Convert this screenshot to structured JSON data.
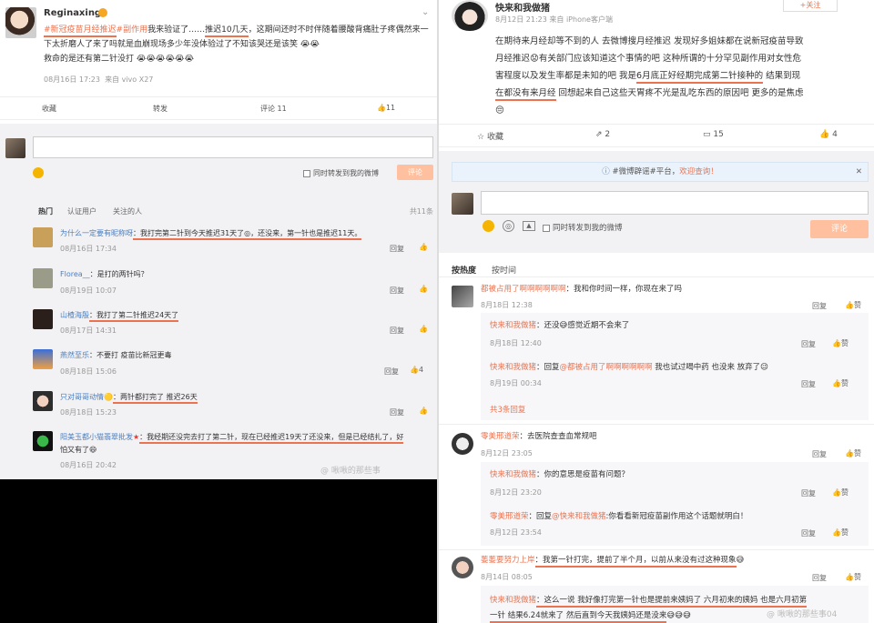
{
  "left": {
    "post": {
      "username": "Reginaxing",
      "tags": [
        "#新冠疫苗月经推迟",
        "#副作用"
      ],
      "text_1": "我来验证了……",
      "text_2": "推迟10几天",
      "text_3": "，这期间还时不时伴随着腰酸背痛肚子",
      "text_4": "疼偶然来一下太折磨人了来了吗就是血崩现场多少年没体验过了不知该哭还是该笑",
      "text_5": "救命的是还有第二针没打",
      "time": "08月16日 17:23",
      "source": "来自 vivo X27"
    },
    "actions": {
      "fav": "收藏",
      "share": "转发",
      "comment": "评论 11",
      "like": "11"
    },
    "composer": {
      "also_share": "同时转发到我的微博",
      "submit": "评论"
    },
    "filters": {
      "hot": "热门",
      "verified": "认证用户",
      "following": "关注的人",
      "count": "共11条"
    },
    "comments": [
      {
        "user": "为什么一定要有昵称呀",
        "text": "：我打完第二针到今天推迟31天了◎，还没来，第一针也是推迟11天。",
        "time": "08月16日 17:34",
        "reply": "回复",
        "likes": ""
      },
      {
        "user": "Florea__",
        "text": "：是打的两针吗？",
        "time": "08月19日 10:07",
        "reply": "回复",
        "likes": ""
      },
      {
        "user": "山楂海殷",
        "text": "：我打了第二针推迟24天了",
        "time": "08月17日 14:31",
        "reply": "回复",
        "likes": ""
      },
      {
        "user": "燕然至乐",
        "text": "：不要打 疫苗比新冠更毒",
        "time": "08月18日 15:06",
        "reply": "回复",
        "likes": "4"
      },
      {
        "user": "只对哥哥动情",
        "text": "：两针都打完了 推迟26天",
        "time": "08月18日 15:23",
        "reply": "回复",
        "likes": ""
      },
      {
        "user": "阳美玉都小猫翡翠批发",
        "text": "：我经期还没完去打了第二针，现在已经推迟19天了还没来，但是已经结扎了，好",
        "text2": "怕又有了",
        "time": "08月16日 20:42",
        "reply": "回复",
        "likes": ""
      }
    ],
    "watermark": "@ 啾啾的那些事"
  },
  "right": {
    "post": {
      "username": "快来和我做猪",
      "time": "8月12日 21:23",
      "source": "来自 iPhone客户端",
      "follow": "+关注",
      "lines": [
        "在期待来月经却等不到的人 去微博搜月经推迟 发现好多姐妹都在说新冠疫苗导致",
        "月经推迟",
        "有关部门应该知道这个事情的吧 这种所谓的十分罕见副作用对女性危",
        "害程度以及发生率都是未知的吧 我是",
        "6月底正好经期完成第二针接种的",
        " 结果到现",
        "在都没有来月经",
        " 回想起来自己这些天胃疼不光是乱吃东西的原因吧 更多的是焦虑"
      ]
    },
    "actions": {
      "fav": "收藏",
      "share": "2",
      "comment": "15",
      "like": "4"
    },
    "notice": {
      "tag": "#微博辟谣#平台，",
      "link": "欢迎查询！"
    },
    "composer": {
      "also_share": "同时转发到我的微博",
      "submit": "评论"
    },
    "filters": {
      "hot": "按热度",
      "time": "按时间"
    },
    "comments": [
      {
        "user": "都被占用了啊啊啊啊啊啊",
        "text": "：我和你时间一样，你现在来了吗",
        "time": "8月18日 12:38",
        "reply": "回复",
        "like": "赞"
      },
      {
        "user": "快来和我做猪",
        "text": "：还没",
        "text_b": "感觉近期不会来了",
        "time": "8月18日 12:40",
        "reply": "回复",
        "like": "赞",
        "sub": true
      },
      {
        "user": "快来和我做猪",
        "text": "：回复",
        "at": "@都被占用了啊啊啊啊啊啊",
        "text_b": " 我也试过喝中药 也没来 放弃了",
        "time": "8月19日 00:34",
        "reply": "回复",
        "like": "赞",
        "sub": true
      },
      {
        "more": "共3条回复"
      },
      {
        "user": "零美邢道荣",
        "text": "：去医院查查血常规吧",
        "time": "8月12日 23:05",
        "reply": "回复",
        "like": "赞"
      },
      {
        "user": "快来和我做猪",
        "text": "：你的意思是疫苗有问题？",
        "time": "8月12日 23:20",
        "reply": "回复",
        "like": "赞",
        "sub": true
      },
      {
        "user": "零美邢道荣",
        "text": "：回复",
        "at": "@快来和我做猪",
        "text_b": ":你看看新冠疫苗副作用这个话题就明白！",
        "time": "8月12日 23:54",
        "reply": "回复",
        "like": "赞",
        "sub": true
      },
      {
        "user": "萎萎要努力上岸",
        "text": "：我第一针打完，提前了半个月，以前从来没有过这种现象",
        "time": "8月14日 08:05",
        "reply": "回复",
        "like": "赞"
      },
      {
        "user": "快来和我做猪",
        "text": "：这么一说 我好像打完第一针也是提前来姨妈了 六月初来的姨妈 也是六月初第",
        "text2": "一针 结果6.24就来了 然后直到今天我姨妈还是没来",
        "sub": true
      }
    ],
    "watermark": "@ 啾啾的那些事04"
  },
  "colors": {
    "accent": "#eb7350",
    "link": "#4a7fc1",
    "orange_btn": "#ffc09f"
  }
}
